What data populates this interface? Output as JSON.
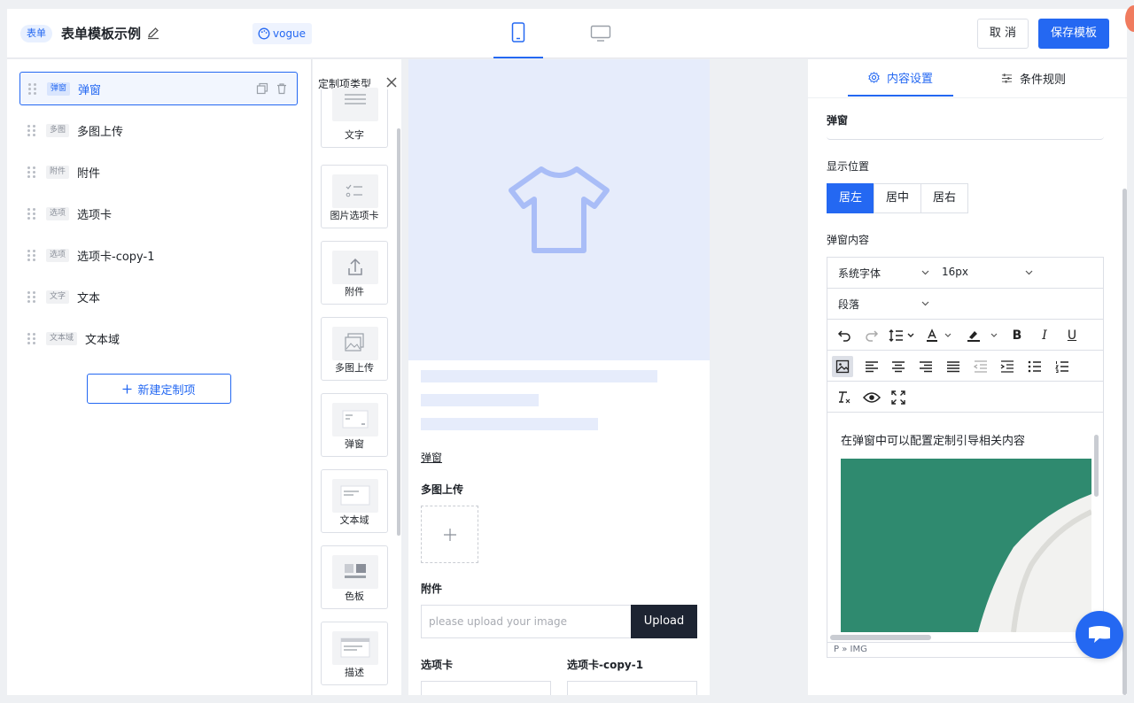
{
  "header": {
    "form_tag": "表单",
    "title": "表单模板示例",
    "theme_label": "vogue",
    "cancel_label": "取 消",
    "save_label": "保存模板"
  },
  "items": [
    {
      "tag": "弹窗",
      "label": "弹窗",
      "selected": true
    },
    {
      "tag": "多图",
      "label": "多图上传"
    },
    {
      "tag": "附件",
      "label": "附件"
    },
    {
      "tag": "选项",
      "label": "选项卡"
    },
    {
      "tag": "选项",
      "label": "选项卡-copy-1"
    },
    {
      "tag": "文字",
      "label": "文本"
    },
    {
      "tag": "文本域",
      "label": "文本域"
    }
  ],
  "new_item_label": "新建定制项",
  "types": {
    "title": "定制项类型",
    "cards": [
      "文字",
      "图片选项卡",
      "附件",
      "多图上传",
      "弹窗",
      "文本域",
      "色板",
      "描述"
    ]
  },
  "preview": {
    "popup_link": "弹窗",
    "multi_upload_label": "多图上传",
    "attachment_label": "附件",
    "upload_placeholder": "please upload your image",
    "upload_button": "Upload",
    "tab_a_label": "选项卡",
    "tab_b_label": "选项卡-copy-1"
  },
  "settings": {
    "tabs": [
      "内容设置",
      "条件规则"
    ],
    "field_name_label": "弹窗",
    "position_label": "显示位置",
    "position_options": [
      "居左",
      "居中",
      "居右"
    ],
    "position_selected": "居左",
    "content_label": "弹窗内容",
    "font_family": "系统字体",
    "font_size": "16px",
    "block_format": "段落",
    "editor_text": "在弹窗中可以配置定制引导相关内容",
    "status_path": "P » IMG"
  },
  "colors": {
    "accent": "#2468f2",
    "editor_image": "#2f8a6f"
  }
}
